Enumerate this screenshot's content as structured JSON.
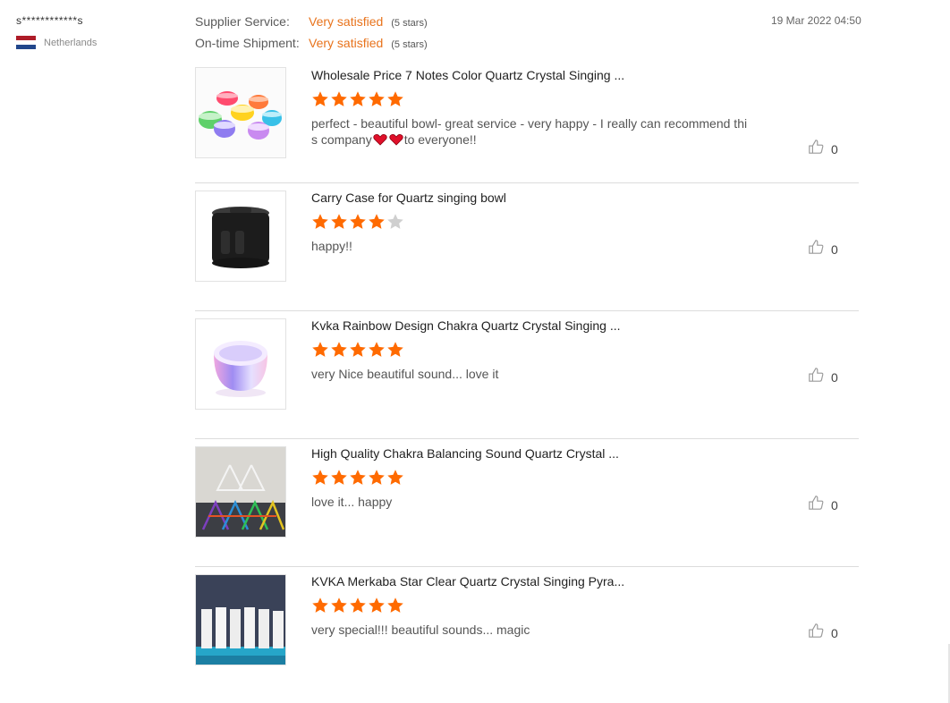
{
  "reviewer": {
    "name": "s************s",
    "country": "Netherlands",
    "flag_colors": [
      "#ae1c28",
      "#ffffff",
      "#21468b"
    ]
  },
  "ratings": [
    {
      "label": "Supplier Service:",
      "value": "Very satisfied",
      "stars_text": "(5 stars)"
    },
    {
      "label": "On-time Shipment:",
      "value": "Very satisfied",
      "stars_text": "(5 stars)"
    }
  ],
  "date": "19 Mar 2022 04:50",
  "colors": {
    "accent": "#ff6a00",
    "star_empty": "#cfcfcf",
    "heart": "#e0102a"
  },
  "reviews": [
    {
      "title": "Wholesale Price 7 Notes Color Quartz Crystal Singing ...",
      "stars": 5,
      "text_before": "perfect - beautiful bowl- great service - very happy - I really can recommend this company",
      "text_after": "to everyone!!",
      "hearts": 2,
      "likes": "0",
      "image": "colored-singing-bowls"
    },
    {
      "title": "Carry Case for Quartz singing bowl",
      "stars": 4,
      "text_before": "happy!!",
      "text_after": "",
      "hearts": 0,
      "likes": "0",
      "image": "black-carry-case"
    },
    {
      "title": "Kvka Rainbow Design Chakra Quartz Crystal Singing ...",
      "stars": 5,
      "text_before": "very  Nice beautiful sound... love it",
      "text_after": "",
      "hearts": 0,
      "likes": "0",
      "image": "rainbow-bowl"
    },
    {
      "title": "High Quality Chakra Balancing Sound Quartz Crystal ...",
      "stars": 5,
      "text_before": "love it... happy",
      "text_after": "",
      "hearts": 0,
      "likes": "0",
      "image": "chakra-pyramids"
    },
    {
      "title": "KVKA Merkaba Star Clear Quartz Crystal Singing Pyra...",
      "stars": 5,
      "text_before": "very special!!! beautiful sounds... magic",
      "text_after": "",
      "hearts": 0,
      "likes": "0",
      "image": "clear-pyramids"
    }
  ]
}
